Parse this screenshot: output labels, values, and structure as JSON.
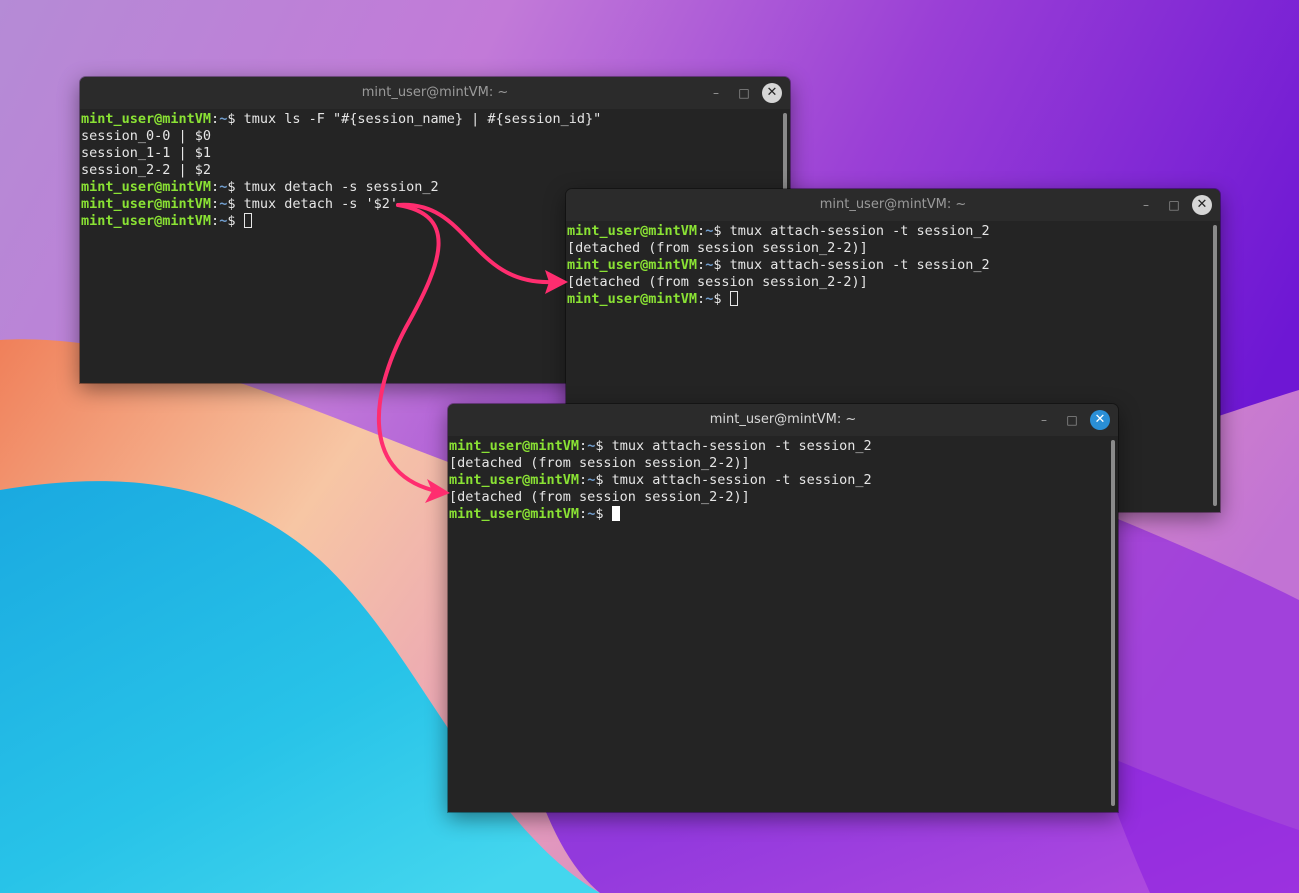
{
  "windows": [
    {
      "title": "mint_user@mintVM: ~",
      "lines": [
        {
          "prompt": {
            "user": "mint_user@mintVM",
            "sep": ":",
            "path": "~",
            "dollar": "$ "
          },
          "text": "tmux ls -F \"#{session_name} | #{session_id}\""
        },
        {
          "text": "session_0-0 | $0"
        },
        {
          "text": "session_1-1 | $1"
        },
        {
          "text": "session_2-2 | $2"
        },
        {
          "prompt": {
            "user": "mint_user@mintVM",
            "sep": ":",
            "path": "~",
            "dollar": "$ "
          },
          "text": "tmux detach -s session_2"
        },
        {
          "prompt": {
            "user": "mint_user@mintVM",
            "sep": ":",
            "path": "~",
            "dollar": "$ "
          },
          "text": "tmux detach -s '$2'"
        },
        {
          "prompt": {
            "user": "mint_user@mintVM",
            "sep": ":",
            "path": "~",
            "dollar": "$ "
          },
          "text": "",
          "cursor": "outline"
        }
      ]
    },
    {
      "title": "mint_user@mintVM: ~",
      "lines": [
        {
          "prompt": {
            "user": "mint_user@mintVM",
            "sep": ":",
            "path": "~",
            "dollar": "$ "
          },
          "text": "tmux attach-session -t session_2"
        },
        {
          "text": "[detached (from session session_2-2)]"
        },
        {
          "prompt": {
            "user": "mint_user@mintVM",
            "sep": ":",
            "path": "~",
            "dollar": "$ "
          },
          "text": "tmux attach-session -t session_2"
        },
        {
          "text": "[detached (from session session_2-2)]"
        },
        {
          "prompt": {
            "user": "mint_user@mintVM",
            "sep": ":",
            "path": "~",
            "dollar": "$ "
          },
          "text": "",
          "cursor": "outline"
        }
      ]
    },
    {
      "title": "mint_user@mintVM: ~",
      "lines": [
        {
          "prompt": {
            "user": "mint_user@mintVM",
            "sep": ":",
            "path": "~",
            "dollar": "$ "
          },
          "text": "tmux attach-session -t session_2"
        },
        {
          "text": "[detached (from session session_2-2)]"
        },
        {
          "prompt": {
            "user": "mint_user@mintVM",
            "sep": ":",
            "path": "~",
            "dollar": "$ "
          },
          "text": "tmux attach-session -t session_2"
        },
        {
          "text": "[detached (from session session_2-2)]"
        },
        {
          "prompt": {
            "user": "mint_user@mintVM",
            "sep": ":",
            "path": "~",
            "dollar": "$ "
          },
          "text": "",
          "cursor": "solid"
        }
      ]
    }
  ],
  "titlebar_buttons": {
    "minimize": "–",
    "maximize": "□",
    "close": "✕"
  },
  "colors": {
    "prompt_user": "#8ae234",
    "prompt_path": "#729fcf",
    "annotation_arrow": "#ff2d6f",
    "active_close": "#2a8fd6"
  }
}
